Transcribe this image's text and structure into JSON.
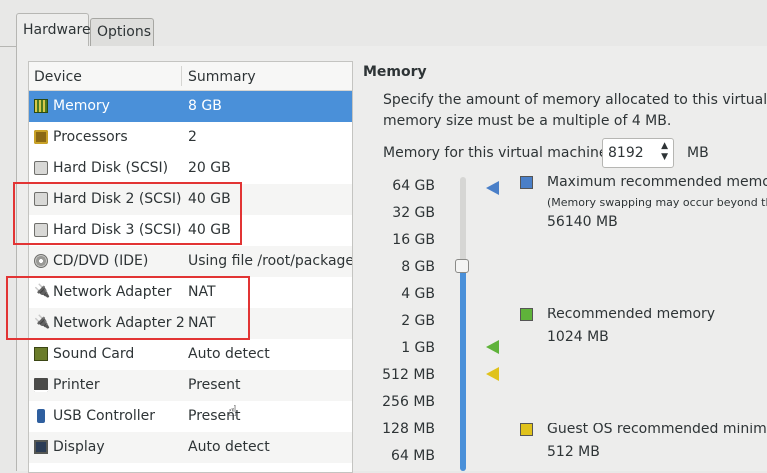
{
  "tabs": [
    {
      "label": "Hardware",
      "active": true
    },
    {
      "label": "Options",
      "active": false
    }
  ],
  "device_list": {
    "columns": {
      "device": "Device",
      "summary": "Summary"
    },
    "rows": [
      {
        "icon": "memory-icon",
        "name": "Memory",
        "summary": "8 GB",
        "selected": true
      },
      {
        "icon": "processor-icon",
        "name": "Processors",
        "summary": "2"
      },
      {
        "icon": "hard-disk-icon",
        "name": "Hard Disk (SCSI)",
        "summary": "20 GB"
      },
      {
        "icon": "hard-disk-icon",
        "name": "Hard Disk 2 (SCSI)",
        "summary": "40 GB"
      },
      {
        "icon": "hard-disk-icon",
        "name": "Hard Disk 3 (SCSI)",
        "summary": "40 GB"
      },
      {
        "icon": "cd-dvd-icon",
        "name": "CD/DVD (IDE)",
        "summary": "Using file /root/package/C"
      },
      {
        "icon": "network-adapter-icon",
        "name": "Network Adapter",
        "summary": "NAT"
      },
      {
        "icon": "network-adapter-icon",
        "name": "Network Adapter 2",
        "summary": "NAT"
      },
      {
        "icon": "sound-card-icon",
        "name": "Sound Card",
        "summary": "Auto detect"
      },
      {
        "icon": "printer-icon",
        "name": "Printer",
        "summary": "Present"
      },
      {
        "icon": "usb-icon",
        "name": "USB Controller",
        "summary": "Present"
      },
      {
        "icon": "display-icon",
        "name": "Display",
        "summary": "Auto detect"
      }
    ]
  },
  "memory_panel": {
    "title": "Memory",
    "description_line1": "Specify the amount of memory allocated to this virtual mac",
    "description_line2": "memory size must be a multiple of 4 MB.",
    "field_label": "Memory for this virtual machine:",
    "field_value": "8192",
    "field_unit": "MB",
    "scale_labels": [
      "64 GB",
      "32 GB",
      "16 GB",
      "8 GB",
      "4 GB",
      "2 GB",
      "1 GB",
      "512 MB",
      "256 MB",
      "128 MB",
      "64 MB"
    ],
    "slider_value_label": "8 GB",
    "legend": {
      "max": {
        "title": "Maximum recommended memory",
        "note": "(Memory swapping may occur beyond th",
        "value": "56140 MB",
        "color": "#4a7fc8"
      },
      "recommended": {
        "title": "Recommended memory",
        "value": "1024 MB",
        "color": "#5fb33a"
      },
      "guest": {
        "title": "Guest OS recommended minimum",
        "value": "512 MB",
        "color": "#e0c21b"
      }
    }
  },
  "colors": {
    "selection": "#4a90d9",
    "highlight_box": "#e23434"
  }
}
